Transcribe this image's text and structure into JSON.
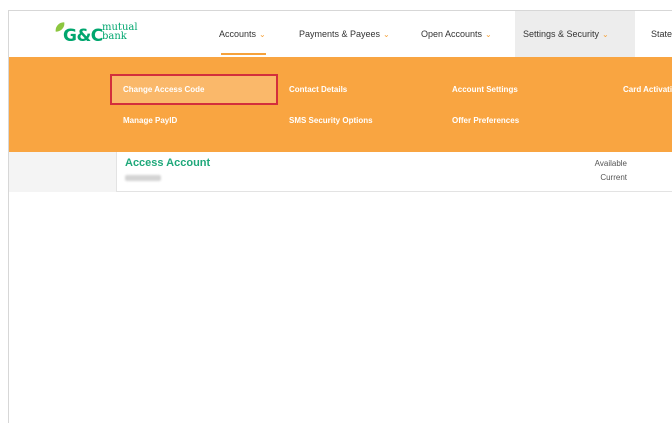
{
  "brand": {
    "logo_main": "G&C",
    "logo_sub_1": "mutual",
    "logo_sub_2": "bank",
    "accent_color": "#f9a541",
    "brand_color": "#00a66e"
  },
  "nav": {
    "accounts": "Accounts",
    "payments": "Payments & Payees",
    "open_accounts": "Open Accounts",
    "settings": "Settings & Security",
    "statements": "State",
    "chevron": "⌄"
  },
  "menu": {
    "change_access_code": "Change Access Code",
    "contact_details": "Contact Details",
    "account_settings": "Account Settings",
    "card_activation": "Card Activatio",
    "manage_payid": "Manage PayID",
    "sms_security": "SMS Security Options",
    "offer_preferences": "Offer Preferences"
  },
  "account": {
    "name": "Access Account",
    "available_label": "Available",
    "current_label": "Current"
  }
}
